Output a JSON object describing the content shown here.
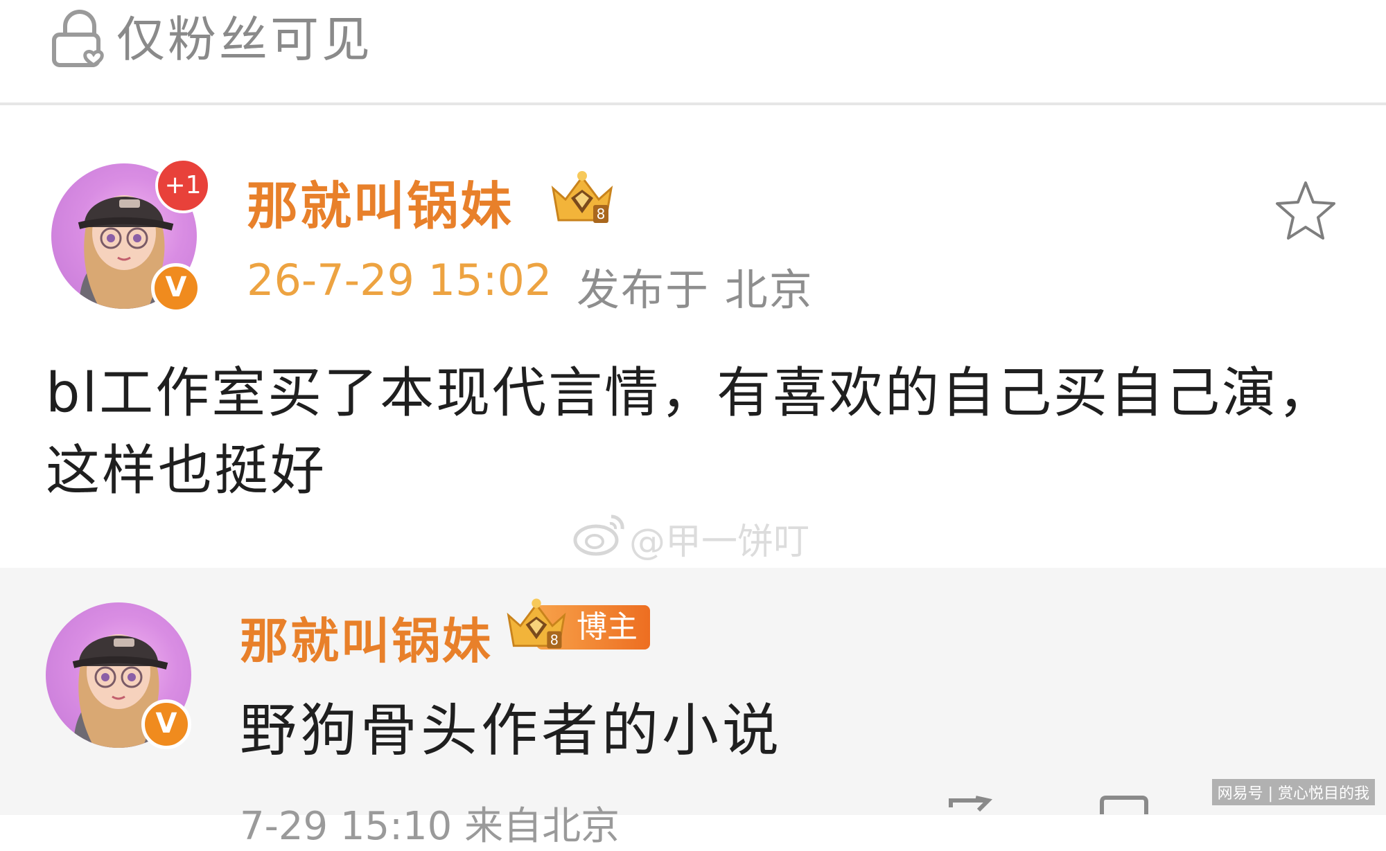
{
  "visibility": {
    "label": "仅粉丝可见",
    "icon": "lock-heart-icon"
  },
  "post": {
    "author": {
      "name": "那就叫锅妹",
      "badge_icon": "diamond-crown-icon",
      "notification_badge": "+1",
      "verified_badge": "V"
    },
    "time": "26-7-29 15:02",
    "location": "发布于 北京",
    "body": "bl工作室买了本现代言情，有喜欢的自己买自己演，这样也挺好",
    "favorite_icon": "star-icon"
  },
  "watermark": {
    "text": "@甲一饼叮",
    "icon": "weibo-logo-icon"
  },
  "comment": {
    "author": {
      "name": "那就叫锅妹",
      "badge_icon": "diamond-crown-icon",
      "role_badge": "博主",
      "verified_badge": "V"
    },
    "text": "野狗骨头作者的小说",
    "meta": "7-29 15:10 来自北京"
  },
  "source_tag": "网易号 | 赏心悦目的我",
  "colors": {
    "accent_orange": "#e8802a",
    "time_orange": "#eda341",
    "gray_text": "#8e8e8e",
    "verified_orange": "#f08b1e",
    "notify_red": "#e8413a"
  }
}
